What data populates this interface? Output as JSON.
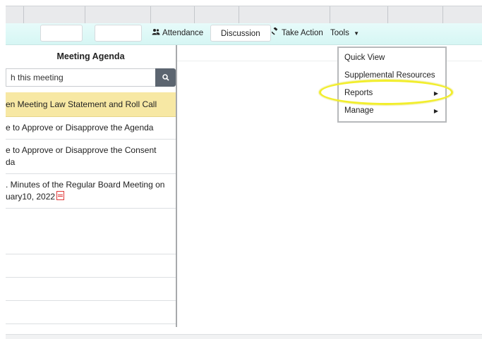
{
  "toolbar": {
    "attendance_label": "Attendance",
    "discussion_label": "Discussion",
    "take_action_label": "Take Action",
    "tools_label": "Tools"
  },
  "agenda": {
    "title": "Meeting Agenda",
    "search_placeholder": "h this meeting",
    "items": [
      {
        "line1": "en Meeting Law Statement and Roll Call",
        "line2": ""
      },
      {
        "line1": "e to Approve or Disapprove the Agenda",
        "line2": ""
      },
      {
        "line1": "e to Approve or Disapprove the Consent",
        "line2": "da"
      },
      {
        "line1": ". Minutes of the Regular Board Meeting on",
        "line2": "uary10, 2022"
      },
      {
        "line1": "",
        "line2": ""
      },
      {
        "line1": "",
        "line2": ""
      },
      {
        "line1": "",
        "line2": ""
      },
      {
        "line1": "",
        "line2": ""
      }
    ]
  },
  "tools_menu": {
    "items": [
      {
        "label": "Quick View",
        "submenu": false
      },
      {
        "label": "Supplemental Resources",
        "submenu": false
      },
      {
        "label": "Reports",
        "submenu": true
      },
      {
        "label": "Manage",
        "submenu": true
      }
    ]
  },
  "colors": {
    "toolbar_bg": "#d6f6f4",
    "active_item_bg": "#f7e8a4",
    "highlight_ring": "#f2ee2c",
    "search_button": "#5c6570",
    "pdf_icon": "#e03a3a"
  }
}
